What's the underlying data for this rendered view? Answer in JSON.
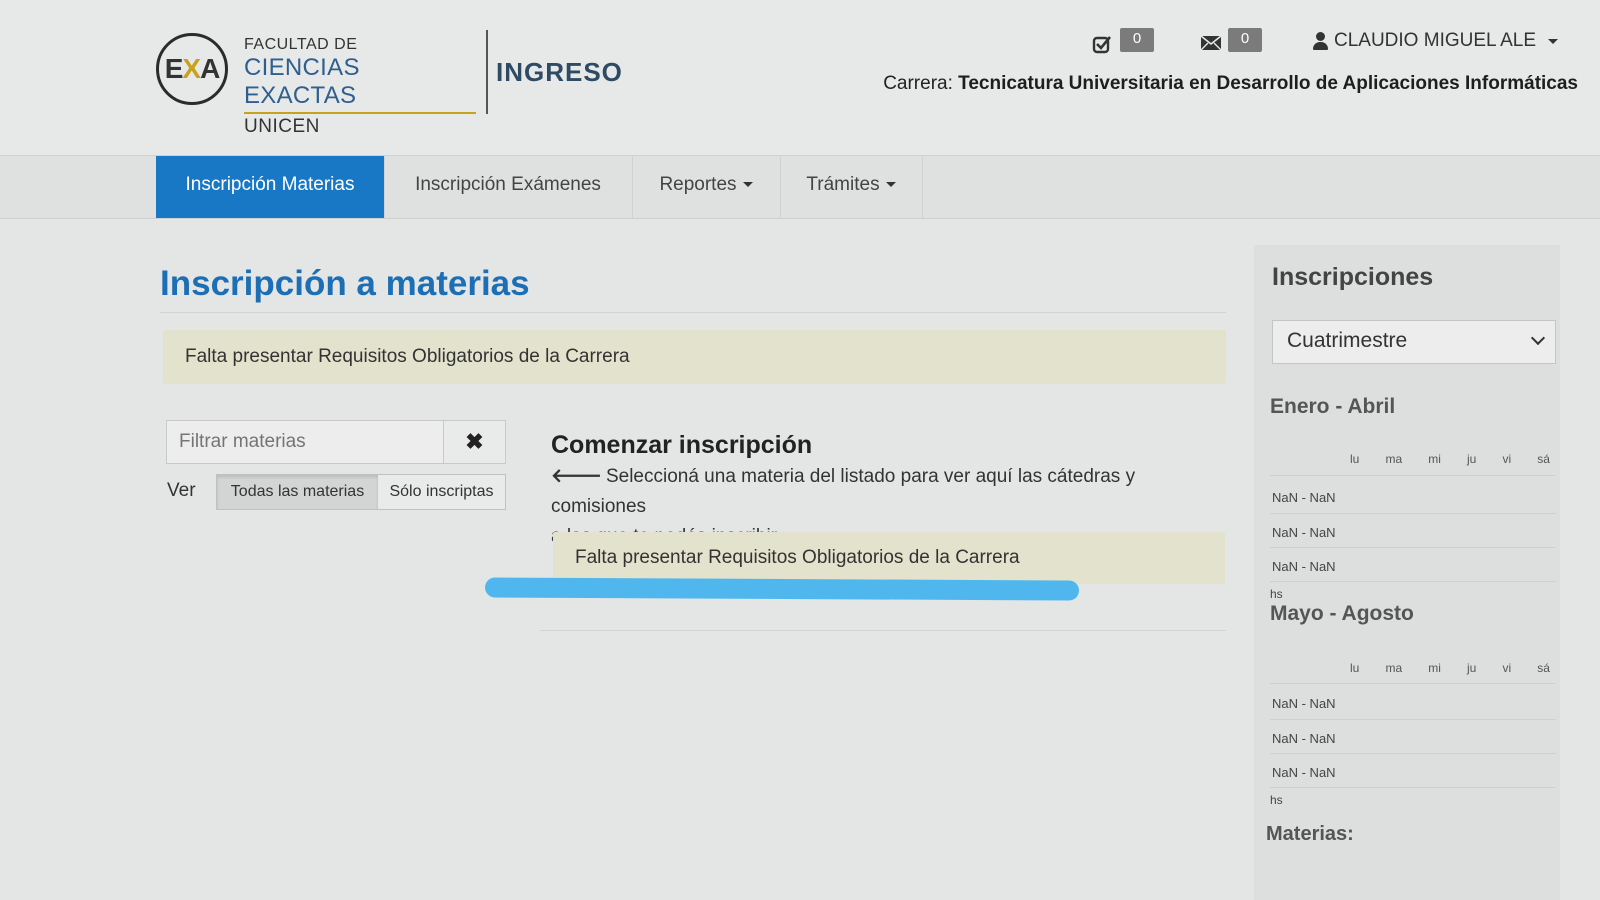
{
  "header": {
    "logo_letters_left": "E",
    "logo_letters_x": "X",
    "logo_letters_right": "A",
    "logo_line1": "FACULTAD DE",
    "logo_line2": "CIENCIAS EXACTAS",
    "logo_line3": "UNICEN",
    "app_section": "INGRESO",
    "tasks_count": "0",
    "messages_count": "0",
    "user_name": "CLAUDIO MIGUEL ALE",
    "carrera_label": "Carrera:",
    "carrera_value": "Tecnicatura Universitaria en Desarrollo de Aplicaciones Informáticas"
  },
  "nav": {
    "items": [
      {
        "label": "Inscripción Materias"
      },
      {
        "label": "Inscripción Exámenes"
      },
      {
        "label": "Reportes"
      },
      {
        "label": "Trámites"
      }
    ]
  },
  "main": {
    "title": "Inscripción a materias",
    "alert": "Falta presentar Requisitos Obligatorios de la Carrera",
    "filter_placeholder": "Filtrar materias",
    "ver_label": "Ver",
    "seg_all": "Todas las materias",
    "seg_enrolled": "Sólo inscriptas",
    "panel_title": "Comenzar inscripción",
    "panel_text_line1": "Seleccioná una materia del listado para ver aquí las cátedras y comisiones",
    "panel_text_line2": "a las que te podés inscribir",
    "panel_alert": "Falta presentar Requisitos Obligatorios de la Carrera",
    "highlight_color": "#4fb7ee"
  },
  "sidebar": {
    "title": "Inscripciones",
    "period_select": "Cuatrimestre",
    "sem1_title": "Enero - Abril",
    "sem2_title": "Mayo - Agosto",
    "days": [
      "lu",
      "ma",
      "mi",
      "ju",
      "vi",
      "sá"
    ],
    "slot": "NaN - NaN",
    "hs": "hs",
    "materias": "Materias:"
  },
  "colors": {
    "accent": "#1878c6",
    "title_blue": "#1d6fb5",
    "alert_bg": "#e3e2cc"
  }
}
